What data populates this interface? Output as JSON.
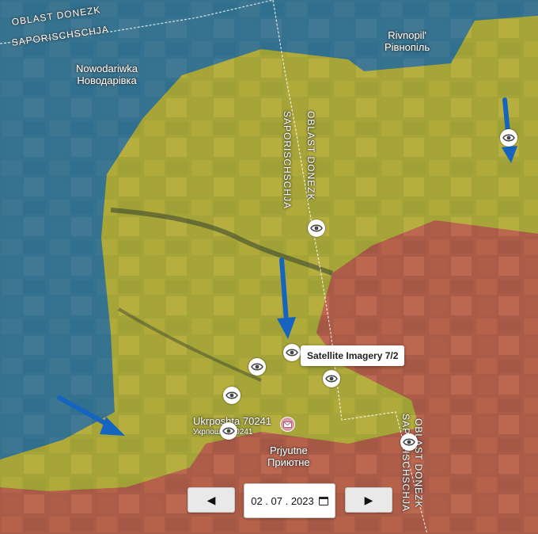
{
  "labels": {
    "oblast_donezk_top": "OBLAST DONEZK",
    "saporischschja_top": "SAPORISCHSCHJA",
    "nowodariwka_latin": "Nowodariwka",
    "nowodariwka_cyrillic": "Новодарівка",
    "rivnopil_latin": "Rivnopil'",
    "rivnopil_cyrillic": "Рівнопіль",
    "saporischschja_border_vertical": "SAPORISCHSCHJA",
    "oblast_donezk_border_vertical": "OBLAST DONEZK",
    "ukrposhta_latin": "Ukrposhta 70241",
    "ukrposhta_cyrillic": "Укрпошта 70241",
    "pryjutne_latin": "Prjyutne",
    "pryjutne_cyrillic": "Приютне",
    "oblast_donezk_bottom": "OBLAST DONEZK",
    "saporischschja_bottom": "SAPORISCHSCHJA"
  },
  "tooltip": "Satellite Imagery 7/2",
  "controls": {
    "prev_label": "◀",
    "next_label": "▶",
    "date": "02 . 07 . 2023"
  },
  "colors": {
    "blue_zone": "#1e6fa8",
    "yellow_zone": "#c8bf2a",
    "red_zone": "#d24a44",
    "arrow": "#1565c0"
  },
  "icons": {
    "observation_marker": "eye-icon",
    "post_office": "mail-icon",
    "date_picker": "calendar-icon"
  }
}
